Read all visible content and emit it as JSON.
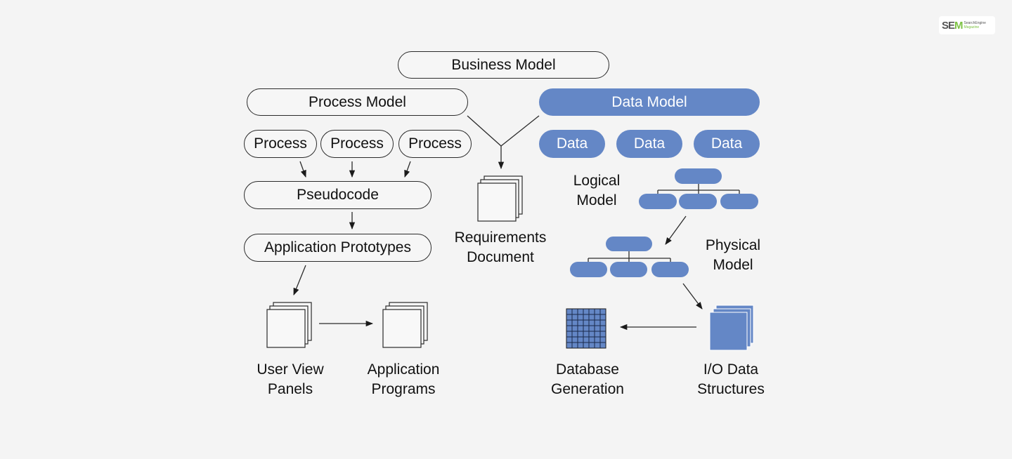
{
  "logo": {
    "brand_prefix": "SE",
    "brand_suffix": "M",
    "line1": "SearchEngine",
    "line2": "Magazine"
  },
  "colors": {
    "accent_blue": "#6487c6",
    "background": "#f4f4f4",
    "stroke": "#2b2b2b"
  },
  "nodes": {
    "business_model": "Business Model",
    "process_model": "Process Model",
    "data_model": "Data Model",
    "processes": [
      "Process",
      "Process",
      "Process"
    ],
    "data_items": [
      "Data",
      "Data",
      "Data"
    ],
    "pseudocode": "Pseudocode",
    "application_prototypes": "Application Prototypes"
  },
  "labels": {
    "requirements_document": [
      "Requirements",
      "Document"
    ],
    "logical_model": [
      "Logical",
      "Model"
    ],
    "physical_model": [
      "Physical",
      "Model"
    ],
    "user_view_panels": [
      "User View",
      "Panels"
    ],
    "application_programs": [
      "Application",
      "Programs"
    ],
    "database_generation": [
      "Database",
      "Generation"
    ],
    "io_data_structures": [
      "I/O Data",
      "Structures"
    ]
  }
}
